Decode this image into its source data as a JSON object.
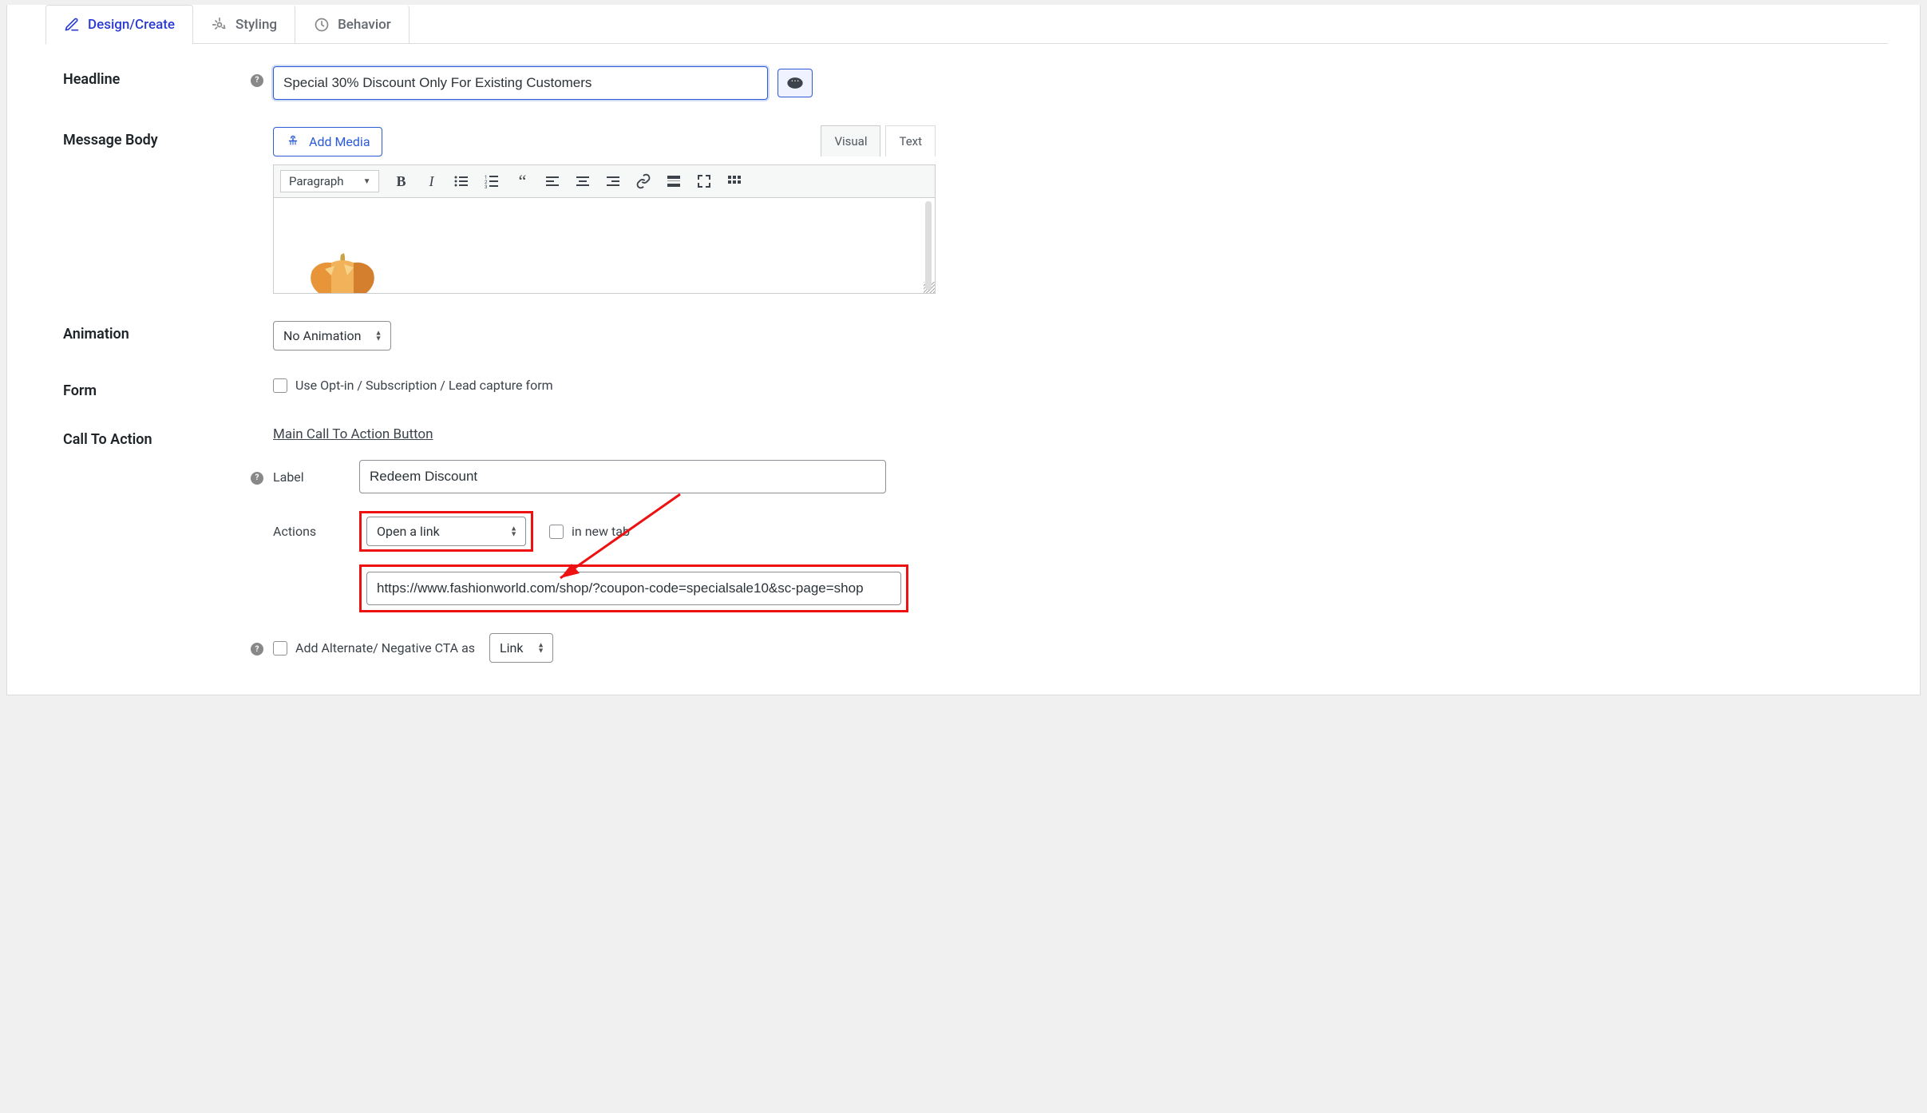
{
  "tabs": {
    "design": "Design/Create",
    "styling": "Styling",
    "behavior": "Behavior"
  },
  "labels": {
    "headline": "Headline",
    "message_body": "Message Body",
    "animation": "Animation",
    "form": "Form",
    "cta": "Call To Action",
    "label": "Label",
    "actions": "Actions"
  },
  "headline": {
    "value": "Special 30% Discount Only For Existing Customers"
  },
  "editor": {
    "add_media": "Add Media",
    "visual_tab": "Visual",
    "text_tab": "Text",
    "format_select": "Paragraph"
  },
  "animation": {
    "selected": "No Animation"
  },
  "form_row": {
    "checkbox_label": "Use Opt-in / Subscription / Lead capture form"
  },
  "cta": {
    "main_heading": "Main Call To Action Button",
    "label_value": "Redeem Discount",
    "action_selected": "Open a link",
    "new_tab_label": "in new tab",
    "url_value": "https://www.fashionworld.com/shop/?coupon-code=specialsale10&sc-page=shop",
    "alt_checkbox_label": "Add Alternate/ Negative CTA as",
    "alt_select": "Link"
  }
}
